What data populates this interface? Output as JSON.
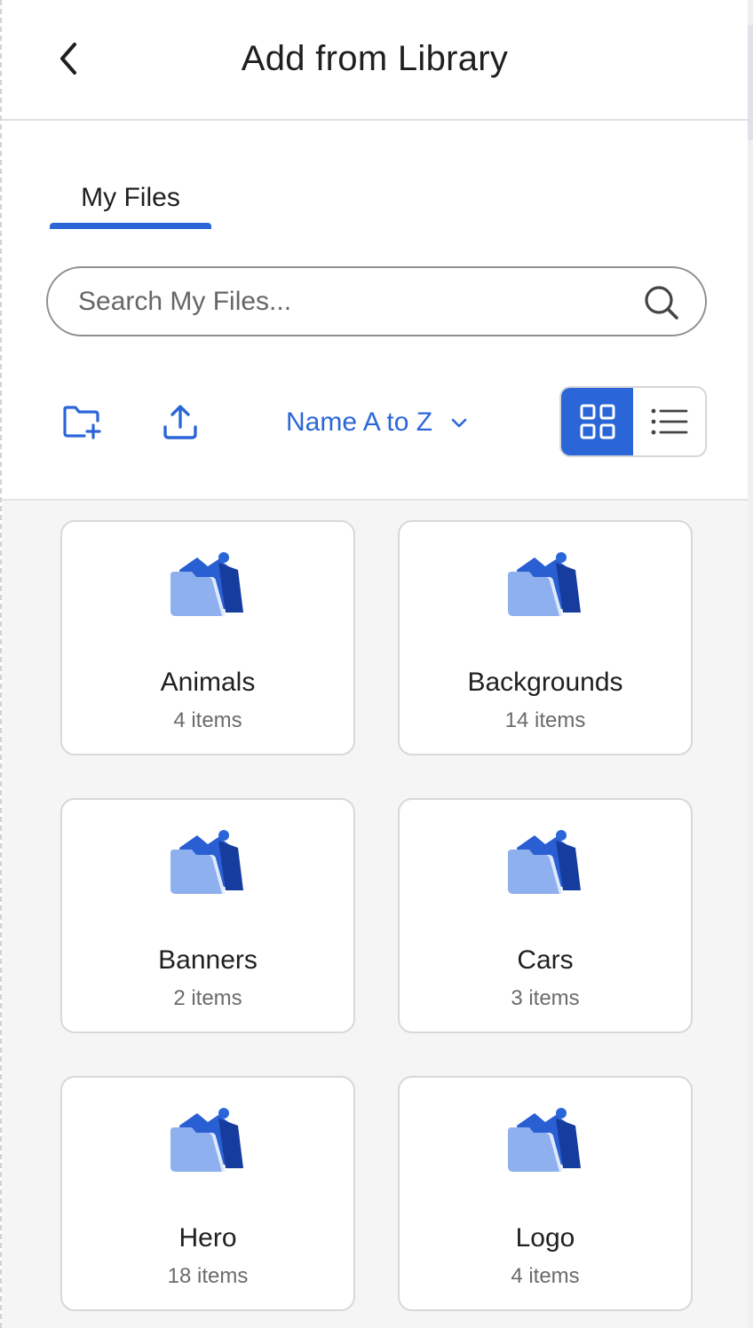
{
  "header": {
    "title": "Add from Library",
    "back_icon": "chevron-left-icon"
  },
  "tabs": [
    {
      "label": "My Files",
      "active": true
    }
  ],
  "search": {
    "placeholder": "Search My Files...",
    "value": "",
    "icon": "search-icon"
  },
  "toolbar": {
    "new_folder_icon": "folder-plus-icon",
    "upload_icon": "upload-icon",
    "sort_label": "Name A to Z",
    "sort_icon": "chevron-down-icon",
    "view_mode": "grid",
    "grid_icon": "grid-view-icon",
    "list_icon": "list-view-icon"
  },
  "folders": [
    {
      "name": "Animals",
      "count": "4 items"
    },
    {
      "name": "Backgrounds",
      "count": "14 items"
    },
    {
      "name": "Banners",
      "count": "2 items"
    },
    {
      "name": "Cars",
      "count": "3 items"
    },
    {
      "name": "Hero",
      "count": "18 items"
    },
    {
      "name": "Logo",
      "count": "4 items"
    }
  ],
  "colors": {
    "accent": "#2b66d9",
    "folder_light": "#8fb0ef",
    "folder_dark": "#1f4fc2",
    "content_bg": "#f5f5f5"
  }
}
